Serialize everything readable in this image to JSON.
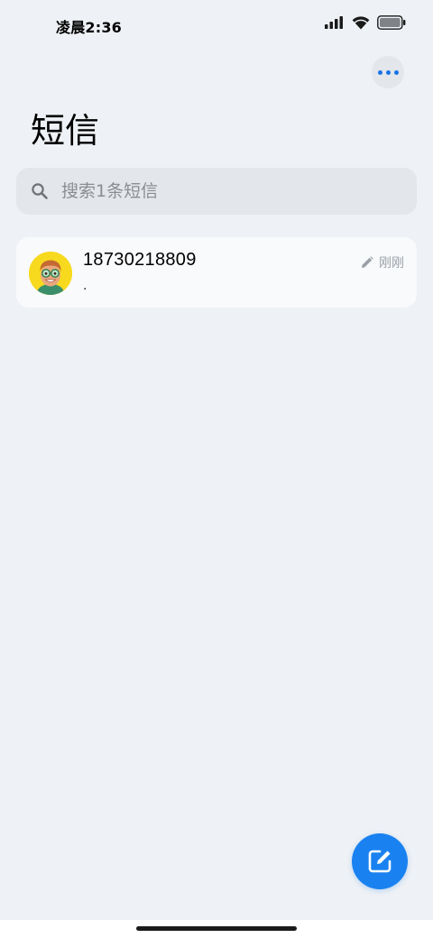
{
  "status_bar": {
    "time": "凌晨2:36"
  },
  "header": {
    "title": "短信",
    "more_icon": "more-horizontal-icon"
  },
  "search": {
    "placeholder": "搜索1条短信",
    "icon": "search-icon"
  },
  "conversations": [
    {
      "name": "18730218809",
      "preview": ".",
      "time": "刚刚",
      "status_icon": "draft-pencil-icon"
    }
  ],
  "compose": {
    "icon": "compose-icon"
  },
  "colors": {
    "accent": "#1a82f0",
    "background": "#eef1f5",
    "card": "#f9fafc",
    "secondary_text": "#9aa0a6"
  }
}
